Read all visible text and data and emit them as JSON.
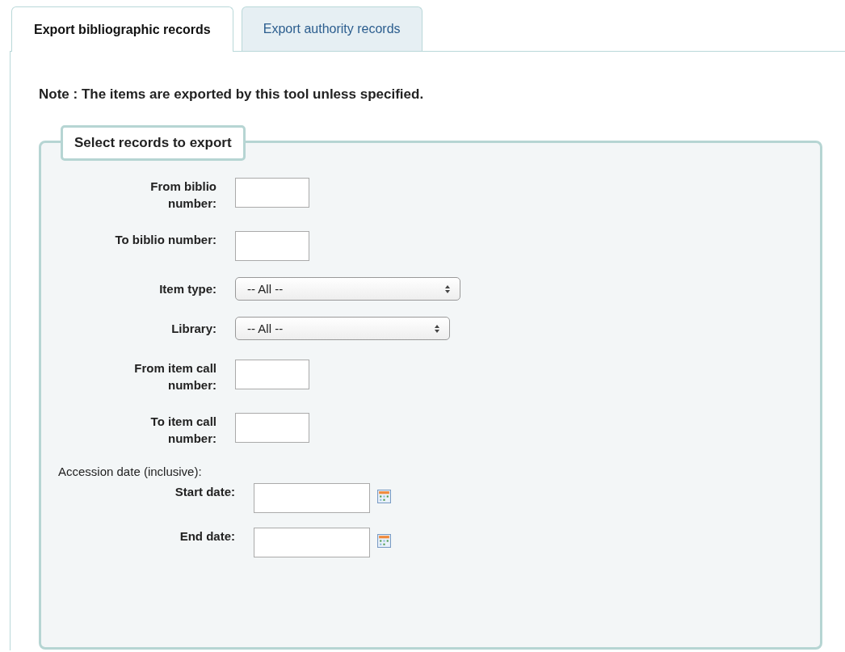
{
  "tabs": [
    {
      "label": "Export bibliographic records",
      "selected": true
    },
    {
      "label": "Export authority records",
      "selected": false
    }
  ],
  "note": "Note : The items are exported by this tool unless specified.",
  "fieldset": {
    "legend": "Select records to export",
    "fields": [
      {
        "kind": "text",
        "label": "From biblio number:"
      },
      {
        "kind": "text",
        "label": "To biblio number:"
      },
      {
        "kind": "select",
        "label": "Item type:",
        "value": "-- All --"
      },
      {
        "kind": "select",
        "label": "Library:",
        "value": "-- All --"
      },
      {
        "kind": "text",
        "label": "From item call number:"
      },
      {
        "kind": "text",
        "label": "To item call number:"
      }
    ],
    "date_heading": "Accession date (inclusive):",
    "dates": [
      {
        "label": "Start date:"
      },
      {
        "label": "End date:"
      }
    ]
  }
}
